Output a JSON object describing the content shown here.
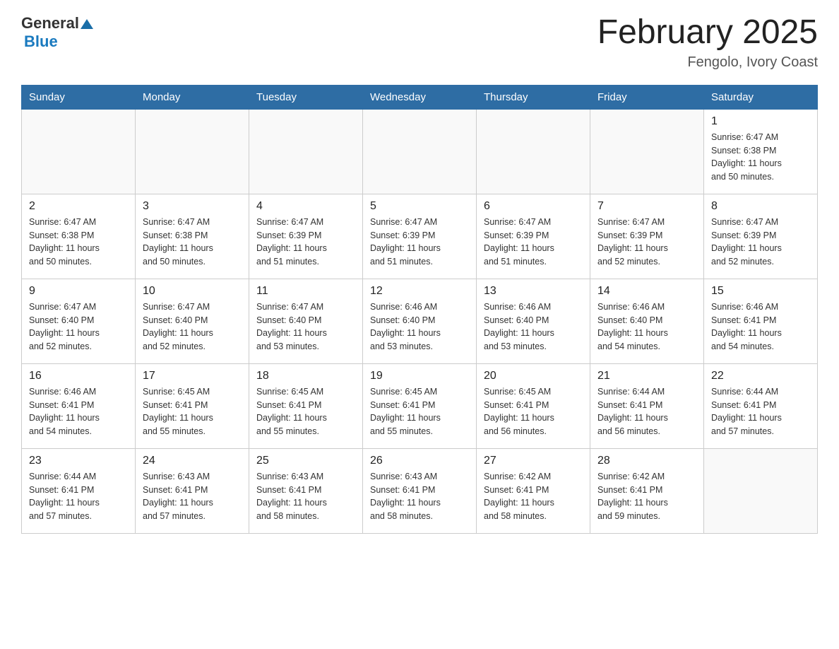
{
  "header": {
    "logo_general": "General",
    "logo_blue": "Blue",
    "title": "February 2025",
    "subtitle": "Fengolo, Ivory Coast"
  },
  "weekdays": [
    "Sunday",
    "Monday",
    "Tuesday",
    "Wednesday",
    "Thursday",
    "Friday",
    "Saturday"
  ],
  "weeks": [
    [
      {
        "day": "",
        "info": ""
      },
      {
        "day": "",
        "info": ""
      },
      {
        "day": "",
        "info": ""
      },
      {
        "day": "",
        "info": ""
      },
      {
        "day": "",
        "info": ""
      },
      {
        "day": "",
        "info": ""
      },
      {
        "day": "1",
        "info": "Sunrise: 6:47 AM\nSunset: 6:38 PM\nDaylight: 11 hours\nand 50 minutes."
      }
    ],
    [
      {
        "day": "2",
        "info": "Sunrise: 6:47 AM\nSunset: 6:38 PM\nDaylight: 11 hours\nand 50 minutes."
      },
      {
        "day": "3",
        "info": "Sunrise: 6:47 AM\nSunset: 6:38 PM\nDaylight: 11 hours\nand 50 minutes."
      },
      {
        "day": "4",
        "info": "Sunrise: 6:47 AM\nSunset: 6:39 PM\nDaylight: 11 hours\nand 51 minutes."
      },
      {
        "day": "5",
        "info": "Sunrise: 6:47 AM\nSunset: 6:39 PM\nDaylight: 11 hours\nand 51 minutes."
      },
      {
        "day": "6",
        "info": "Sunrise: 6:47 AM\nSunset: 6:39 PM\nDaylight: 11 hours\nand 51 minutes."
      },
      {
        "day": "7",
        "info": "Sunrise: 6:47 AM\nSunset: 6:39 PM\nDaylight: 11 hours\nand 52 minutes."
      },
      {
        "day": "8",
        "info": "Sunrise: 6:47 AM\nSunset: 6:39 PM\nDaylight: 11 hours\nand 52 minutes."
      }
    ],
    [
      {
        "day": "9",
        "info": "Sunrise: 6:47 AM\nSunset: 6:40 PM\nDaylight: 11 hours\nand 52 minutes."
      },
      {
        "day": "10",
        "info": "Sunrise: 6:47 AM\nSunset: 6:40 PM\nDaylight: 11 hours\nand 52 minutes."
      },
      {
        "day": "11",
        "info": "Sunrise: 6:47 AM\nSunset: 6:40 PM\nDaylight: 11 hours\nand 53 minutes."
      },
      {
        "day": "12",
        "info": "Sunrise: 6:46 AM\nSunset: 6:40 PM\nDaylight: 11 hours\nand 53 minutes."
      },
      {
        "day": "13",
        "info": "Sunrise: 6:46 AM\nSunset: 6:40 PM\nDaylight: 11 hours\nand 53 minutes."
      },
      {
        "day": "14",
        "info": "Sunrise: 6:46 AM\nSunset: 6:40 PM\nDaylight: 11 hours\nand 54 minutes."
      },
      {
        "day": "15",
        "info": "Sunrise: 6:46 AM\nSunset: 6:41 PM\nDaylight: 11 hours\nand 54 minutes."
      }
    ],
    [
      {
        "day": "16",
        "info": "Sunrise: 6:46 AM\nSunset: 6:41 PM\nDaylight: 11 hours\nand 54 minutes."
      },
      {
        "day": "17",
        "info": "Sunrise: 6:45 AM\nSunset: 6:41 PM\nDaylight: 11 hours\nand 55 minutes."
      },
      {
        "day": "18",
        "info": "Sunrise: 6:45 AM\nSunset: 6:41 PM\nDaylight: 11 hours\nand 55 minutes."
      },
      {
        "day": "19",
        "info": "Sunrise: 6:45 AM\nSunset: 6:41 PM\nDaylight: 11 hours\nand 55 minutes."
      },
      {
        "day": "20",
        "info": "Sunrise: 6:45 AM\nSunset: 6:41 PM\nDaylight: 11 hours\nand 56 minutes."
      },
      {
        "day": "21",
        "info": "Sunrise: 6:44 AM\nSunset: 6:41 PM\nDaylight: 11 hours\nand 56 minutes."
      },
      {
        "day": "22",
        "info": "Sunrise: 6:44 AM\nSunset: 6:41 PM\nDaylight: 11 hours\nand 57 minutes."
      }
    ],
    [
      {
        "day": "23",
        "info": "Sunrise: 6:44 AM\nSunset: 6:41 PM\nDaylight: 11 hours\nand 57 minutes."
      },
      {
        "day": "24",
        "info": "Sunrise: 6:43 AM\nSunset: 6:41 PM\nDaylight: 11 hours\nand 57 minutes."
      },
      {
        "day": "25",
        "info": "Sunrise: 6:43 AM\nSunset: 6:41 PM\nDaylight: 11 hours\nand 58 minutes."
      },
      {
        "day": "26",
        "info": "Sunrise: 6:43 AM\nSunset: 6:41 PM\nDaylight: 11 hours\nand 58 minutes."
      },
      {
        "day": "27",
        "info": "Sunrise: 6:42 AM\nSunset: 6:41 PM\nDaylight: 11 hours\nand 58 minutes."
      },
      {
        "day": "28",
        "info": "Sunrise: 6:42 AM\nSunset: 6:41 PM\nDaylight: 11 hours\nand 59 minutes."
      },
      {
        "day": "",
        "info": ""
      }
    ]
  ]
}
